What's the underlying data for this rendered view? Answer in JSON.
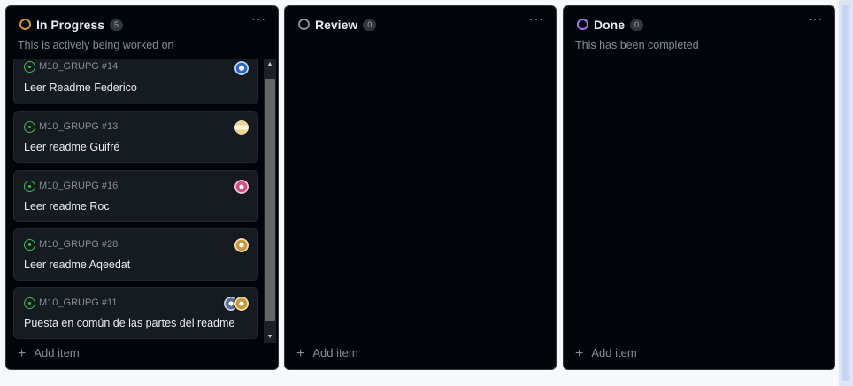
{
  "columns": [
    {
      "title": "In Progress",
      "count": "5",
      "description": "This is actively being worked on",
      "status_color": "#d29922",
      "more_label": "···",
      "add_label": "Add item",
      "cards": [
        {
          "ref": "M10_GRUPG #14",
          "title": "Leer Readme Federico"
        },
        {
          "ref": "M10_GRUPG #13",
          "title": "Leer readme Guifré"
        },
        {
          "ref": "M10_GRUPG #16",
          "title": "Leer readme Roc"
        },
        {
          "ref": "M10_GRUPG #28",
          "title": "Leer readme Aqeedat"
        },
        {
          "ref": "M10_GRUPG #11",
          "title": "Puesta en común de las partes del readme"
        }
      ]
    },
    {
      "title": "Review",
      "count": "0",
      "description": "",
      "status_color": "#848d97",
      "more_label": "···",
      "add_label": "Add item",
      "cards": []
    },
    {
      "title": "Done",
      "count": "0",
      "description": "This has been completed",
      "status_color": "#a371f7",
      "more_label": "···",
      "add_label": "Add item",
      "cards": []
    }
  ],
  "scrollbar": {
    "up_glyph": "▲",
    "down_glyph": "▼"
  }
}
